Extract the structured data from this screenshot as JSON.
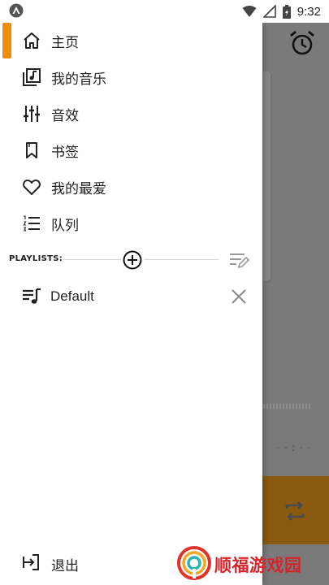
{
  "status_bar": {
    "time": "9:32",
    "icons": [
      "android-app-icon",
      "wifi-icon",
      "signal-icon",
      "battery-icon"
    ]
  },
  "drawer": {
    "accent_color": "#f18b0a",
    "nav_items": [
      {
        "label": "主页",
        "icon": "home-icon",
        "active": true
      },
      {
        "label": "我的音乐",
        "icon": "music-library-icon",
        "active": false
      },
      {
        "label": "音效",
        "icon": "equalizer-icon",
        "active": false
      },
      {
        "label": "书签",
        "icon": "bookmark-icon",
        "active": false
      },
      {
        "label": "我的最爱",
        "icon": "heart-icon",
        "active": false
      },
      {
        "label": "队列",
        "icon": "queue-icon",
        "active": false
      }
    ],
    "playlists": {
      "header": "PLAYLISTS:",
      "items": [
        {
          "label": "Default",
          "icon": "playlist-icon"
        }
      ]
    },
    "exit": {
      "label": "退出",
      "icon": "exit-icon"
    }
  },
  "background_app": {
    "time_display": "--:--",
    "icons": [
      "alarm-icon",
      "repeat-icon"
    ]
  },
  "watermark": {
    "text": "顺福游戏园"
  }
}
